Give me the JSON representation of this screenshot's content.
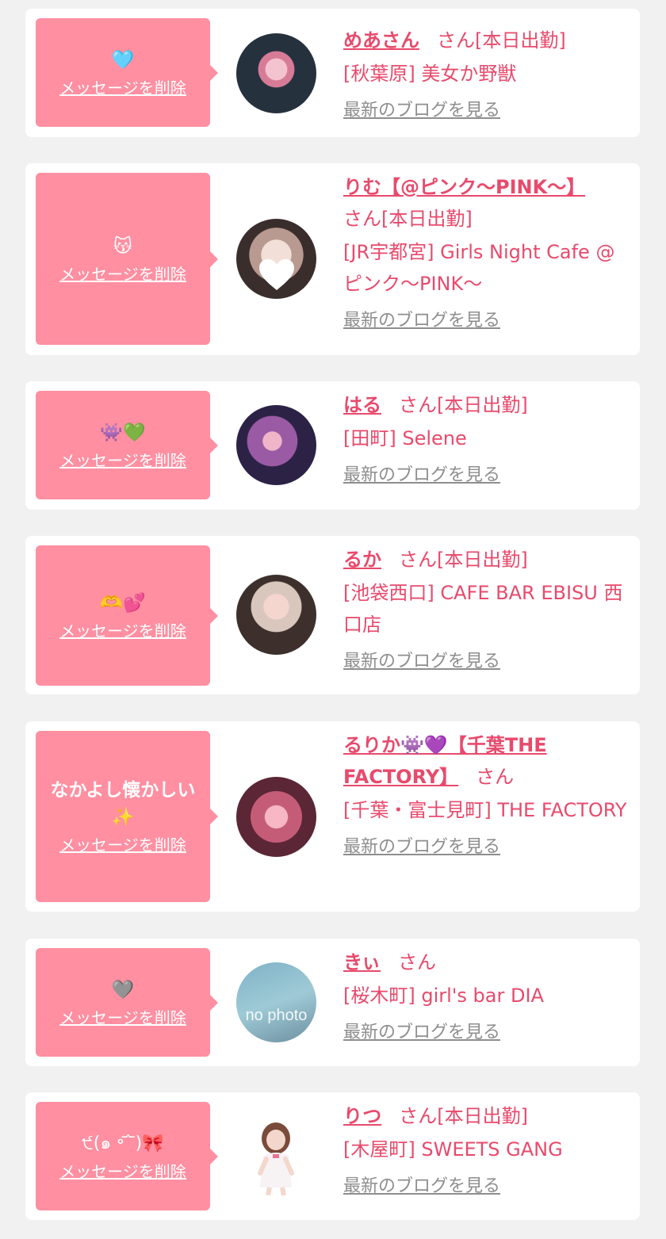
{
  "list": {
    "delete_label": "メッセージを削除",
    "san_suffix": "さん",
    "blog_label": "最新のブログを見る",
    "avatar_placeholder": "no photo"
  },
  "entries": [
    {
      "message": "🩵",
      "name": "めあさん",
      "status": "[本日出勤]",
      "shop": "[秋葉原] 美女か野獣"
    },
    {
      "message": "😽",
      "name": "りむ【@ピンク〜PINK〜】",
      "status": "[本日出勤]",
      "shop": "[JR宇都宮] Girls Night Cafe @ピンク〜PINK〜"
    },
    {
      "message": "👾💚",
      "name": "はる",
      "status": "[本日出勤]",
      "shop": "[田町] Selene"
    },
    {
      "message": "🫶💕",
      "name": "るか",
      "status": "[本日出勤]",
      "shop": "[池袋西口] CAFE BAR EBISU 西口店"
    },
    {
      "message": "なかよし懐かしい✨",
      "name": "るりか👾💜【千葉THE FACTORY】",
      "status": "",
      "shop": "[千葉・富士見町] THE FACTORY"
    },
    {
      "message": "🩶",
      "name": "きぃ",
      "status": "",
      "shop": "[桜木町] girl's bar DIA"
    },
    {
      "message": "੯(๑ ॰ ᷄ ᷅)🎀",
      "name": "りつ",
      "status": "[本日出勤]",
      "shop": "[木屋町] SWEETS GANG"
    }
  ]
}
